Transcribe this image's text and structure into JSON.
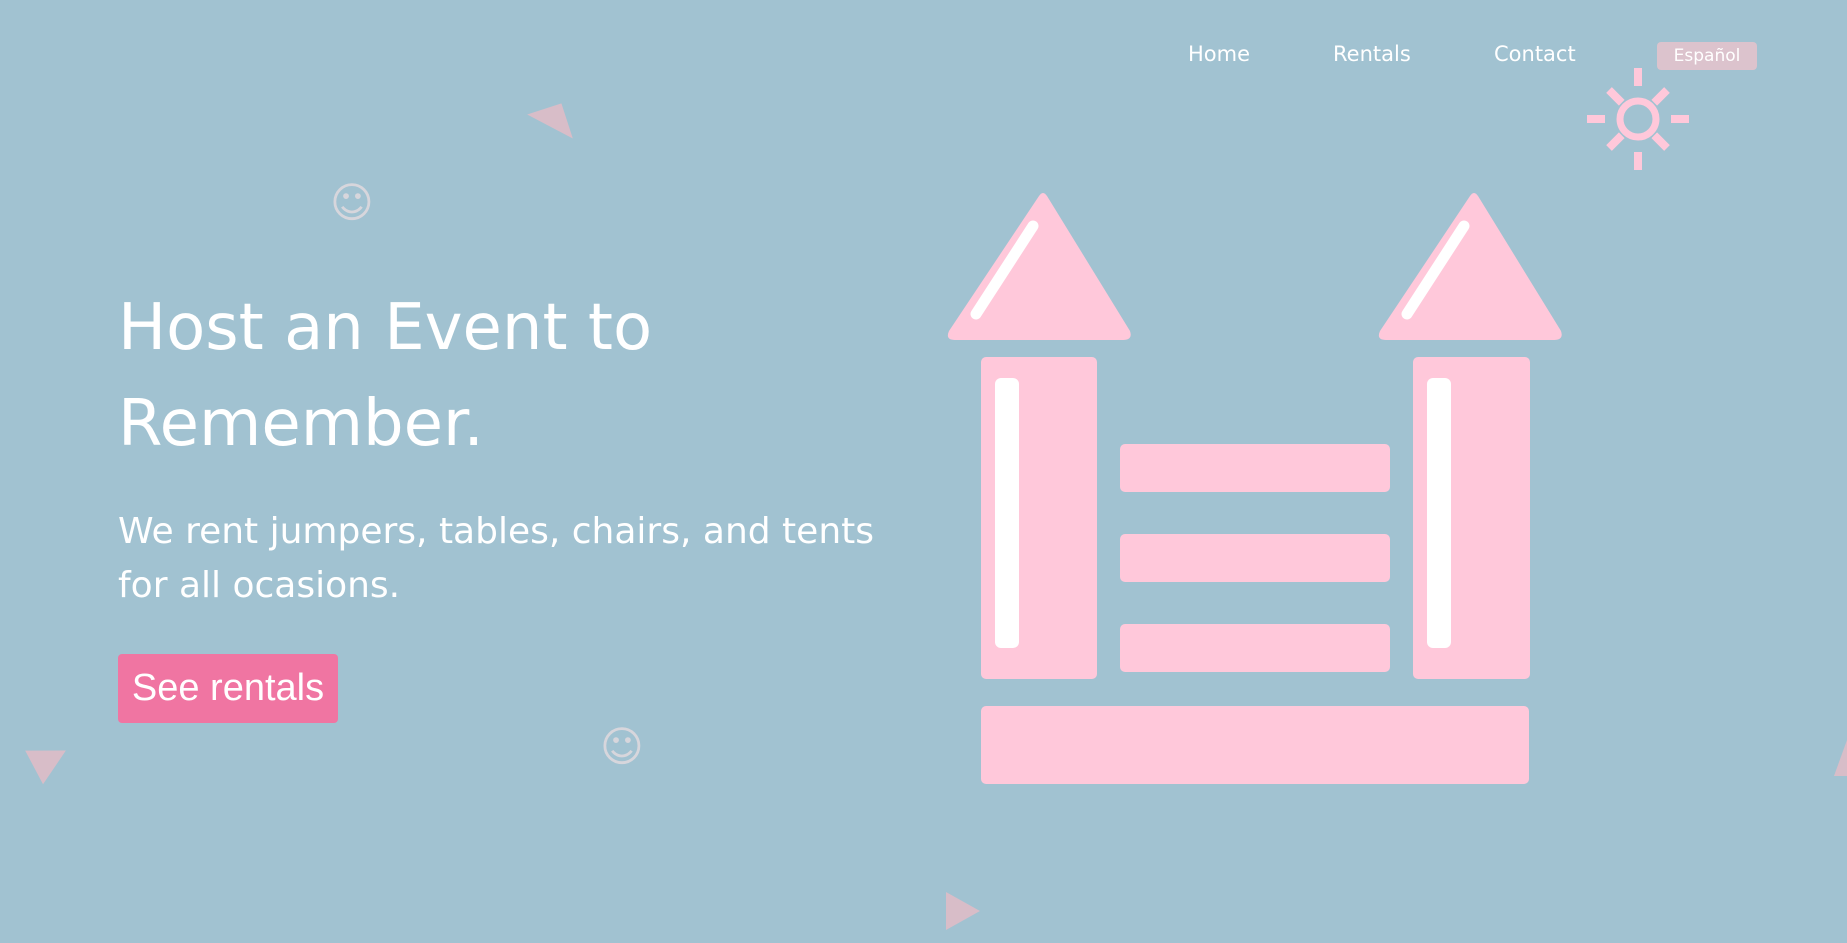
{
  "nav": {
    "items": [
      {
        "label": "Home"
      },
      {
        "label": "Rentals"
      },
      {
        "label": "Contact"
      }
    ],
    "language_button": "Español"
  },
  "hero": {
    "title": "Host an Event to Remember.",
    "subtitle": "We rent jumpers, tables, chairs, and tents for all ocasions.",
    "cta_label": "See rentals"
  },
  "decorations": {
    "smiley_glyph": "☺",
    "icons": [
      "bounce-house-icon",
      "sun-icon",
      "triangle-icon",
      "smiley-icon"
    ]
  },
  "colors": {
    "background": "#a1c2d1",
    "accent_pink": "#f075a2",
    "illustration_pink": "#ffc8da",
    "text": "#ffffff",
    "triangle": "#d8bdc8"
  }
}
